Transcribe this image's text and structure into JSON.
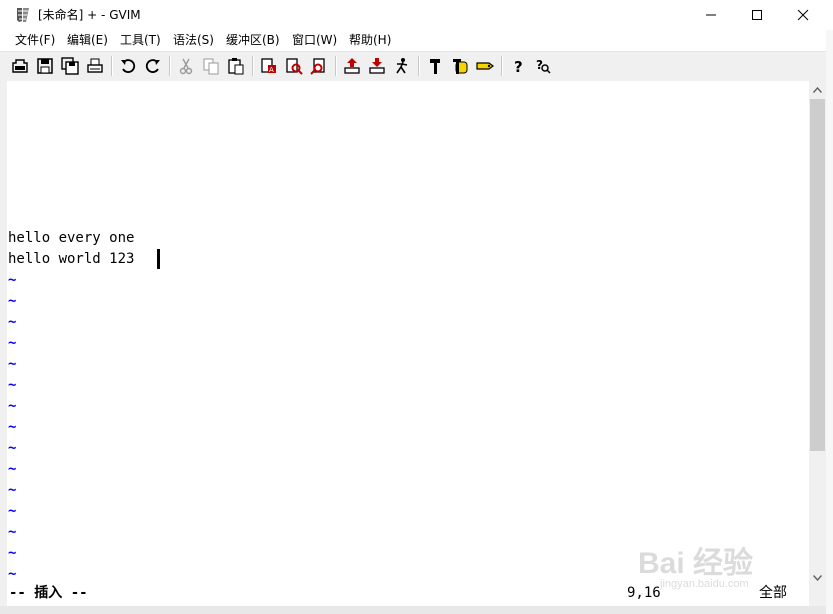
{
  "window": {
    "title": "[未命名] + - GVIM",
    "minimize_label": "minimize",
    "maximize_label": "maximize",
    "close_label": "close"
  },
  "menu": [
    {
      "label": "文件(F)"
    },
    {
      "label": "编辑(E)"
    },
    {
      "label": "工具(T)"
    },
    {
      "label": "语法(S)"
    },
    {
      "label": "缓冲区(B)"
    },
    {
      "label": "窗口(W)"
    },
    {
      "label": "帮助(H)"
    }
  ],
  "toolbar": {
    "icons": [
      "open-icon",
      "save-icon",
      "save-all-icon",
      "print-icon",
      "undo-icon",
      "redo-icon",
      "cut-icon",
      "copy-icon",
      "paste-icon",
      "replace-icon",
      "find-next-icon",
      "find-prev-icon",
      "load-session-icon",
      "save-session-icon",
      "run-script-icon",
      "make-icon",
      "shell-icon",
      "ctags-icon",
      "help-icon",
      "find-help-icon"
    ]
  },
  "editor": {
    "lines": [
      "hello every one",
      "hello world 123"
    ],
    "tilde": "~",
    "tilde_count": 15
  },
  "status": {
    "mode": "-- 插入 --",
    "position": "9,16",
    "scroll": "全部"
  },
  "watermark": {
    "main": "Bai 经验",
    "sub": "jingyan.baidu.com"
  }
}
